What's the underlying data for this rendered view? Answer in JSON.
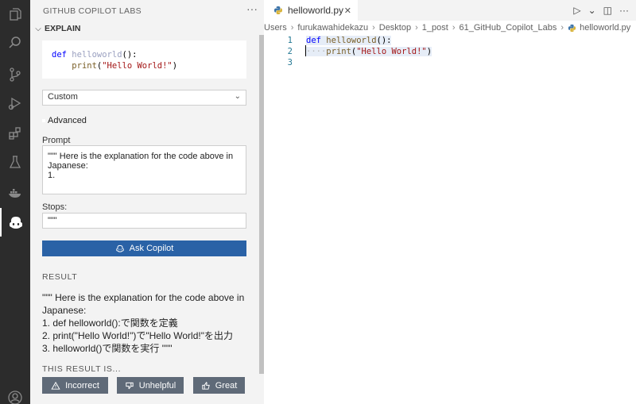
{
  "activity_bar": {
    "icons": [
      "explorer-icon",
      "search-icon",
      "source-control-icon",
      "run-debug-icon",
      "extensions-icon",
      "testing-icon",
      "docker-icon",
      "copilot-labs-icon",
      "account-icon"
    ]
  },
  "sidebar": {
    "title": "GITHUB COPILOT LABS",
    "more": "···",
    "section_label": "EXPLAIN",
    "code_lines": [
      {
        "kw": "def",
        "name": "helloworld",
        "rest": "():"
      },
      {
        "indent": "    ",
        "fn": "print",
        "open": "(",
        "str": "\"Hello World!\"",
        "close": ")"
      }
    ],
    "select_value": "Custom",
    "advanced_label": "Advanced",
    "prompt_label": "Prompt",
    "prompt_value": "\"\"\" Here is the explanation for the code above in\nJapanese:\n1.",
    "stops_label": "Stops:",
    "stops_value": "\"\"\"",
    "ask_button": "Ask Copilot",
    "result_heading": "RESULT",
    "result_lines": [
      "\"\"\" Here is the explanation for the code above in",
      "Japanese:",
      "1. def helloworld():で関数を定義",
      "2. print(\"Hello World!\")で\"Hello World!\"を出力",
      "3. helloworld()で関数を実行 \"\"\""
    ],
    "this_result_heading": "THIS RESULT IS...",
    "feedback": {
      "incorrect": "Incorrect",
      "unhelpful": "Unhelpful",
      "great": "Great"
    }
  },
  "editor": {
    "tab_label": "helloworld.py",
    "breadcrumbs": [
      "Users",
      "furukawahidekazu",
      "Desktop",
      "1_post",
      "61_GitHub_Copilot_Labs",
      "helloworld.py"
    ],
    "line_numbers": [
      "1",
      "2",
      "3"
    ],
    "lines": [
      {
        "kw": "def",
        "name": "helloworld",
        "rest": "():"
      },
      {
        "ws": "····",
        "fn": "print",
        "open": "(",
        "str": "\"Hello World!\"",
        "close": ")"
      },
      {}
    ]
  },
  "colors": {
    "activity_bar": "#2c2c2c",
    "sidebar": "#f3f3f3",
    "primary_button": "#2a62a6",
    "feedback_button": "#5f6a78"
  }
}
